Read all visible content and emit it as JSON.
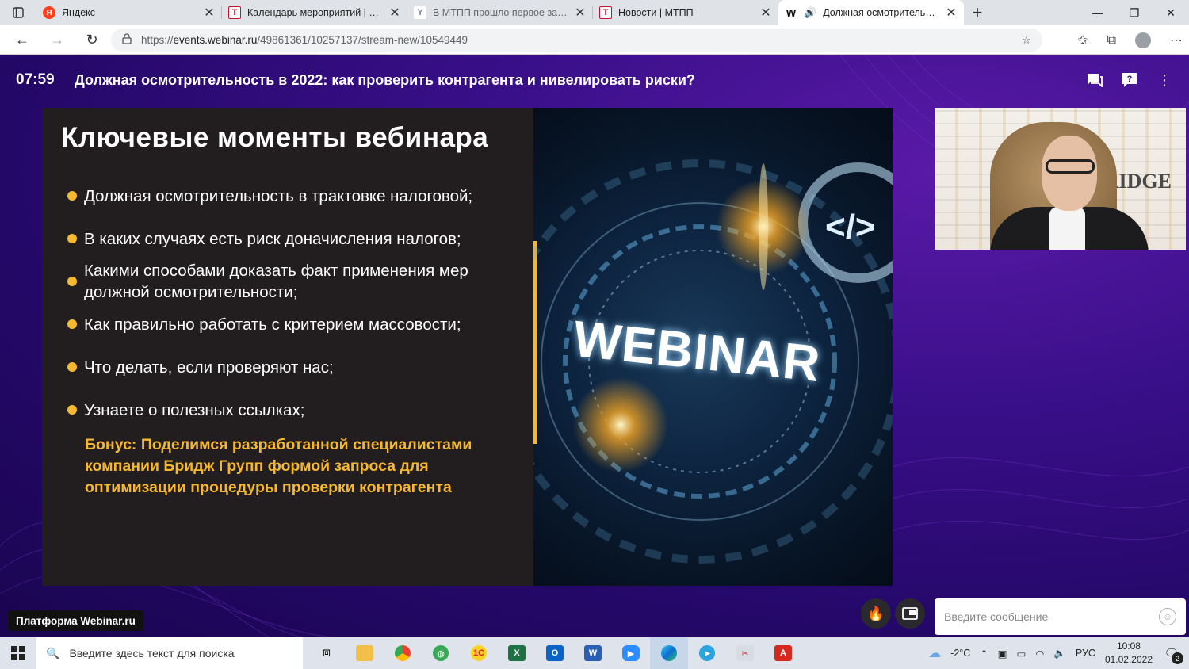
{
  "browser": {
    "tabs": [
      {
        "title": "Яндекс",
        "icon": "yandex-favicon",
        "active": false
      },
      {
        "title": "Календарь мероприятий | МТПП",
        "icon": "mtpp-favicon",
        "active": false
      },
      {
        "title": "В МТПП прошло первое заседание",
        "icon": "mtpp-favicon",
        "active": false
      },
      {
        "title": "Новости | МТПП",
        "icon": "mtpp-favicon",
        "active": false
      },
      {
        "title": "Должная осмотрительность",
        "icon": "webinar-favicon",
        "active": true
      }
    ],
    "url_scheme": "https://",
    "url_host": "events.webinar.ru",
    "url_path": "/49861361/10257137/stream-new/10549449"
  },
  "webinar": {
    "timer": "07:59",
    "title": "Должная осмотрительность в 2022: как проверить контрагента и нивелировать риски?",
    "slide": {
      "heading": "Ключевые моменты вебинара",
      "bullets": [
        "Должная осмотрительность в трактовке налоговой;",
        "В каких случаях есть риск доначисления налогов;",
        "Какими способами доказать факт применения мер должной осмотрительности;",
        "Как правильно работать с критерием массовости;",
        "Что делать, если проверяют нас;",
        "Узнаете о полезных ссылках;"
      ],
      "bonus": "Бонус: Поделимся разработанной специалистами компании Бридж Групп формой запроса для оптимизации процедуры проверки контрагента",
      "image_word": "WEBINAR"
    },
    "camera_brand": "RIDGE",
    "platform_label": "Платформа Webinar.ru",
    "message_placeholder": "Введите сообщение",
    "accent_color": "#f5b82e"
  },
  "taskbar": {
    "search_placeholder": "Введите здесь текст для поиска",
    "temperature": "-2°C",
    "language": "РУС",
    "time": "10:08",
    "date": "01.02.2022",
    "notifications": "2"
  }
}
